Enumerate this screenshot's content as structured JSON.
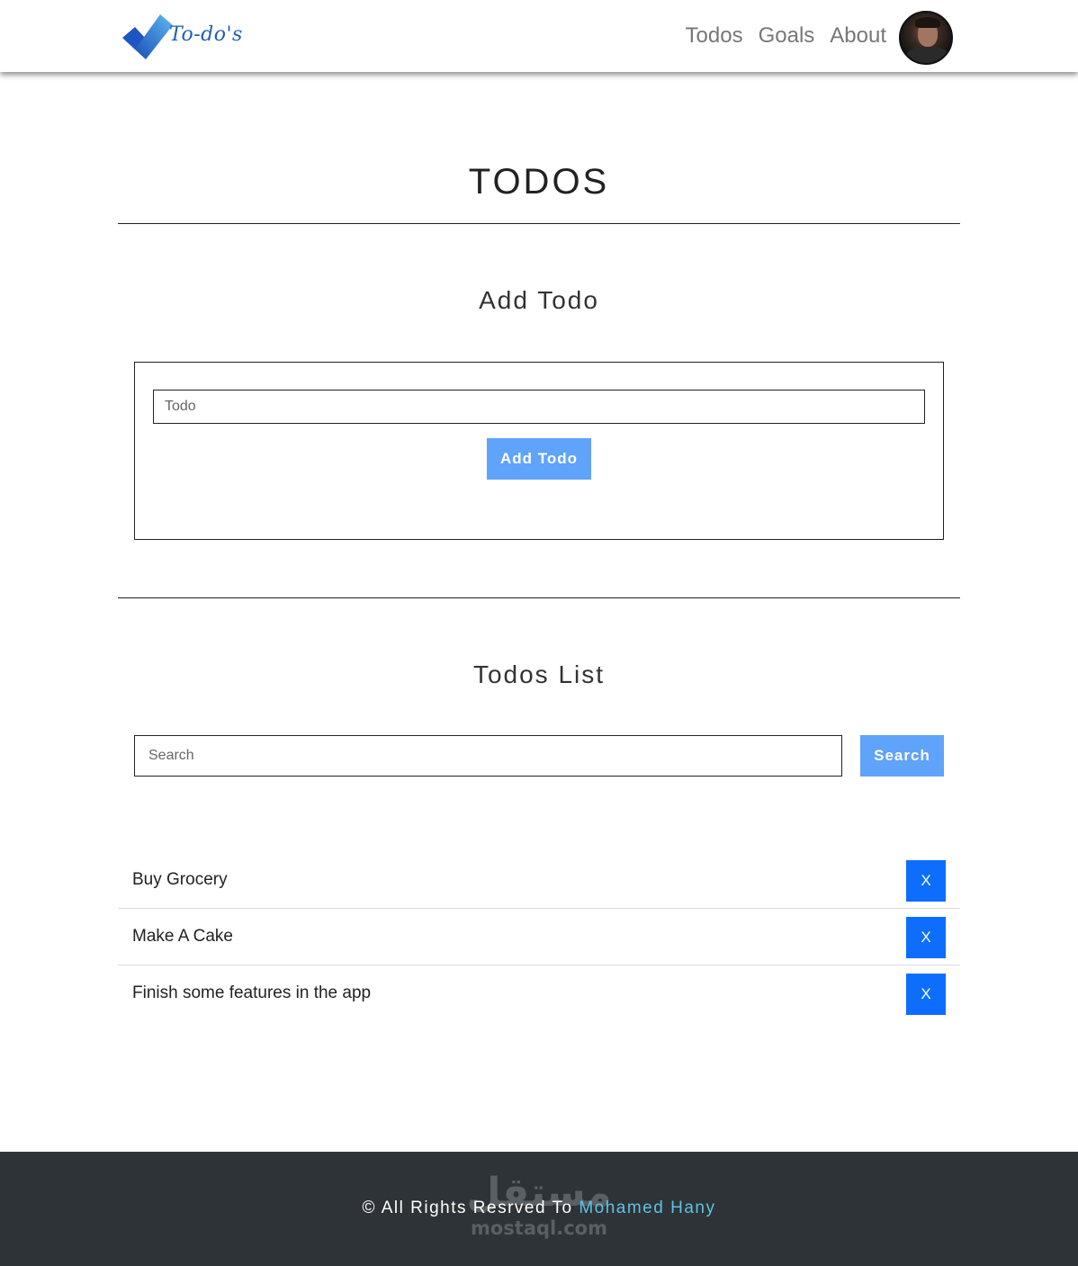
{
  "header": {
    "logo_text": "To-do's",
    "nav": [
      "Todos",
      "Goals",
      "About"
    ]
  },
  "main": {
    "title": "TODOS",
    "add_section": {
      "title": "Add Todo",
      "input_placeholder": "Todo",
      "button_label": "Add Todo"
    },
    "list_section": {
      "title": "Todos List",
      "search_placeholder": "Search",
      "search_button_label": "Search",
      "items": [
        {
          "text": "Buy Grocery",
          "delete_label": "X"
        },
        {
          "text": "Make A Cake",
          "delete_label": "X"
        },
        {
          "text": "Finish some features in the app",
          "delete_label": "X"
        }
      ]
    }
  },
  "footer": {
    "copyright_prefix": "© All Rights Resrved To ",
    "author": "Mohamed Hany",
    "watermark_ar": "مستقل",
    "watermark_en": "mostaql.com"
  },
  "colors": {
    "accent_light": "#5fa3fb",
    "accent_primary": "#0d6efd",
    "footer_bg": "#2e3337",
    "footer_link": "#5ec2e6"
  }
}
